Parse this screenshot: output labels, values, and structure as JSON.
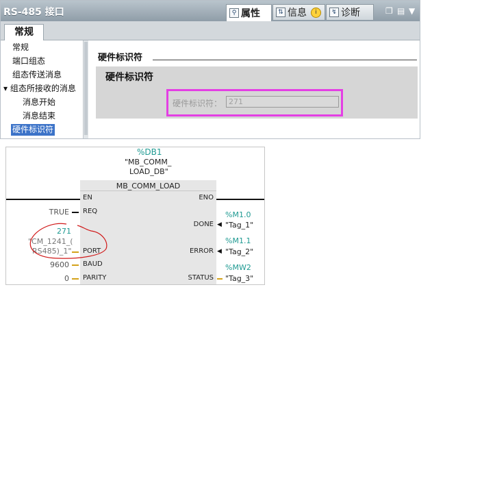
{
  "window": {
    "title": "RS-485 接口"
  },
  "top_tabs": [
    {
      "label": "属性",
      "icon": "properties-icon"
    },
    {
      "label": "信息",
      "icon": "info-icon"
    },
    {
      "label": "诊断",
      "icon": "diagnostics-icon"
    }
  ],
  "general_tab": {
    "label": "常规"
  },
  "nav": {
    "items": [
      {
        "label": "常规"
      },
      {
        "label": "端口组态"
      },
      {
        "label": "组态传送消息"
      },
      {
        "label": "▾ 组态所接收的消息"
      },
      {
        "label": "消息开始"
      },
      {
        "label": "消息结束"
      },
      {
        "label": "硬件标识符"
      }
    ]
  },
  "content": {
    "section_title": "硬件标识符",
    "group_title": "硬件标识符",
    "field_label": "硬件标识符：",
    "field_value": "271"
  },
  "diagram": {
    "db_address": "%DB1",
    "db_name_1": "\"MB_COMM_",
    "db_name_2": "LOAD_DB\"",
    "block_name": "MB_COMM_LOAD",
    "pins_in": {
      "en": "EN",
      "req": "REQ",
      "port": "PORT",
      "baud": "BAUD",
      "parity": "PARITY"
    },
    "pins_out": {
      "eno": "ENO",
      "done": "DONE",
      "error": "ERROR",
      "status": "STATUS"
    },
    "inputs": {
      "req": "TRUE",
      "port_value": "271",
      "port_name_1": "\"CM_1241_(",
      "port_name_2": "RS485)_1\"",
      "baud": "9600",
      "parity": "0"
    },
    "outputs": {
      "done_addr": "%M1.0",
      "done_tag": "\"Tag_1\"",
      "error_addr": "%M1.1",
      "error_tag": "\"Tag_2\"",
      "status_addr": "%MW2",
      "status_tag": "\"Tag_3\""
    },
    "colors": {
      "address": "#1f9a92",
      "annotation": "#d01818",
      "highlight": "#e43fe4"
    }
  }
}
